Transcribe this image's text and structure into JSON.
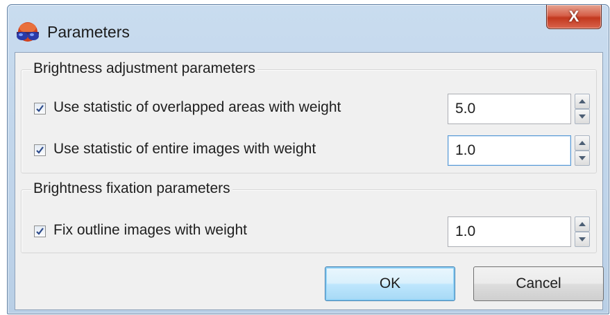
{
  "window": {
    "title": "Parameters",
    "close_label": "X",
    "colors": {
      "titlebar": "#c9dcef",
      "close": "#c2381f",
      "client": "#f0f0f0"
    }
  },
  "adjustment_group": {
    "title": "Brightness adjustment parameters",
    "rows": [
      {
        "label": "Use statistic of overlapped areas with weight",
        "checked": true,
        "value": "5.0"
      },
      {
        "label": "Use statistic of entire images with weight",
        "checked": true,
        "value": "1.0"
      }
    ]
  },
  "fixation_group": {
    "title": "Brightness fixation parameters",
    "rows": [
      {
        "label": "Fix outline images with weight",
        "checked": true,
        "value": "1.0"
      }
    ]
  },
  "buttons": {
    "ok": "OK",
    "cancel": "Cancel"
  },
  "icons": [
    "app-glasses-icon",
    "close-icon",
    "check-icon",
    "spin-up-icon",
    "spin-down-icon"
  ]
}
